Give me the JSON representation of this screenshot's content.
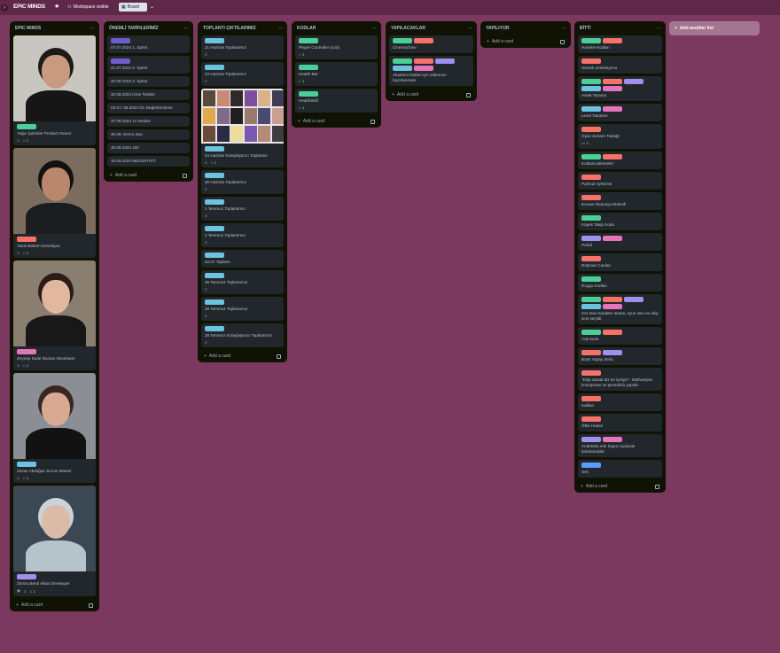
{
  "board": {
    "title": "EPIC MINDS",
    "visibility": "Workspace visible",
    "view": "Board",
    "add_list": "Add another list"
  },
  "colors": {
    "green": "#4bce97",
    "red": "#f87168",
    "purple": "#9f8fef",
    "blue": "#6cc3e0",
    "pink": "#e774bb",
    "darkpurple": "#6e5dc6",
    "cobalt": "#579dff"
  },
  "add_card_label": "Add a card",
  "lists": [
    {
      "title": "EPIC MINDS",
      "cards": [
        {
          "title": "Yağız Şahinler Product Owner",
          "labels": [
            "green"
          ],
          "badges": {
            "desc": true,
            "attach": "1"
          },
          "photo": "person-1"
        },
        {
          "title": "Yasin Bekem Developer",
          "labels": [
            "red"
          ],
          "badges": {
            "desc": true,
            "attach": "1"
          },
          "photo": "person-2"
        },
        {
          "title": "Zeynep Sude Duman Developer",
          "labels": [
            "pink"
          ],
          "badges": {
            "desc": true,
            "attach": "1"
          },
          "photo": "person-3"
        },
        {
          "title": "Zozan Akdoğan Scrum Master",
          "labels": [
            "blue"
          ],
          "badges": {
            "desc": true,
            "attach": "1"
          },
          "photo": "person-4"
        },
        {
          "title": "Zümra Betül Alkan Developer",
          "labels": [
            "purple"
          ],
          "badges": {
            "watch": true,
            "desc": true,
            "attach": "1"
          },
          "photo": "person-5"
        }
      ]
    },
    {
      "title": "ÖNEMLİ TARİHLERİMİZ",
      "cards": [
        {
          "title": "07.07.2024 1. Sprint",
          "labels": [
            "darkpurple"
          ]
        },
        {
          "title": "21.07.2024 2. Sprint",
          "labels": [
            "darkpurple"
          ]
        },
        {
          "title": "32.08.2024 3. Sprint",
          "labels": []
        },
        {
          "title": "32.08.2024 Ürün Teslimi",
          "labels": []
        },
        {
          "title": "03-07. 08.2024 Ön Değerlendirme",
          "labels": []
        },
        {
          "title": "37.08.2024 14 Reailer",
          "labels": []
        },
        {
          "title": "30.08. Demo Day",
          "labels": []
        },
        {
          "title": "30.08.2024 Jüri",
          "labels": []
        },
        {
          "title": "16.09.2024 MEZUNİYET",
          "labels": []
        }
      ]
    },
    {
      "title": "TOPLANTI ÇIKTILARIMIZ",
      "cards": [
        {
          "title": "21 Haziran Toplantımız",
          "labels": [
            "blue"
          ],
          "badges": {
            "desc": true
          }
        },
        {
          "title": "23 Haziran Toplantımız",
          "labels": [
            "blue"
          ],
          "badges": {
            "desc": true
          }
        },
        {
          "title": "24 Haziran Kolaylaştırıcı Toplantısı",
          "labels": [
            "blue"
          ],
          "badges": {
            "desc": true,
            "attach": "1"
          },
          "collage": true
        },
        {
          "title": "30 Haziran Toplantımız",
          "labels": [
            "blue"
          ],
          "badges": {
            "desc": true
          }
        },
        {
          "title": "1 Temmuz Toplantımız",
          "labels": [
            "blue"
          ],
          "badges": {
            "desc": true
          }
        },
        {
          "title": "4 Temmuz Toplantımız",
          "labels": [
            "blue"
          ],
          "badges": {
            "desc": true
          }
        },
        {
          "title": "22.07 Toplantı",
          "labels": [
            "blue"
          ],
          "badges": {}
        },
        {
          "title": "26 Temmuz Toplantımız",
          "labels": [
            "blue"
          ],
          "badges": {
            "desc": true
          }
        },
        {
          "title": "30 Temmuz Toplantımız",
          "labels": [
            "blue"
          ],
          "badges": {
            "desc": true
          }
        },
        {
          "title": "29 Temmuz Kolaylaştırıcı Toplantımız",
          "labels": [
            "blue"
          ],
          "badges": {
            "desc": true
          }
        }
      ]
    },
    {
      "title": "KODLAR",
      "cards": [
        {
          "title": "Player Controller (cod)",
          "labels": [
            "green"
          ],
          "badges": {
            "attach": "1"
          }
        },
        {
          "title": "Health Bar",
          "labels": [
            "green"
          ],
          "badges": {
            "attach": "1"
          }
        },
        {
          "title": "HealthSkill",
          "labels": [
            "green"
          ],
          "badges": {
            "attach": "1"
          }
        }
      ]
    },
    {
      "title": "YAPILACAKLAR",
      "cards": [
        {
          "title": "Cinemachine",
          "labels": [
            "green",
            "red"
          ]
        },
        {
          "title": "Akademi testleri için videonun hazırlanması",
          "labels": [
            "green",
            "red",
            "purple",
            "blue",
            "pink"
          ]
        }
      ]
    },
    {
      "title": "YAPILIYOR",
      "cards": []
    },
    {
      "title": "BİTTİ",
      "cards": [
        {
          "title": "Hareket Kodları",
          "labels": [
            "green",
            "red"
          ]
        },
        {
          "title": "Sandık animasyonu",
          "labels": [
            "red"
          ]
        },
        {
          "title": "Asset Tarama",
          "labels": [
            "green",
            "red",
            "purple",
            "blue",
            "pink"
          ]
        },
        {
          "title": "Level Tasarımı",
          "labels": [
            "blue",
            "pink"
          ]
        },
        {
          "title": "Oyun Senaro Taslağı",
          "labels": [
            "red"
          ],
          "badges": {
            "comments": "1"
          }
        },
        {
          "title": "Kodlara Bilemeler",
          "labels": [
            "green",
            "red"
          ]
        },
        {
          "title": "Partical Systems",
          "labels": [
            "red"
          ]
        },
        {
          "title": "Envaer Reposya Eklendi",
          "labels": [
            "red"
          ]
        },
        {
          "title": "Köpek Takip Kodu",
          "labels": [
            "green"
          ]
        },
        {
          "title": "Portal",
          "labels": [
            "purple",
            "pink"
          ]
        },
        {
          "title": "Düşman Canları",
          "labels": [
            "red"
          ]
        },
        {
          "title": "Duygu Kodları",
          "labels": [
            "green"
          ]
        },
        {
          "title": "2'er tane karakter asseti, oyun ismi ve ekip ismi seçildi.",
          "labels": [
            "green",
            "red",
            "purple",
            "blue",
            "pink"
          ]
        },
        {
          "title": "Ada kodu",
          "labels": [
            "green",
            "red"
          ]
        },
        {
          "title": "Boss Yapay Zeka",
          "labels": [
            "red",
            "purple"
          ]
        },
        {
          "title": "\"Ekip olarak biz en iyisiyiz\"- Motivasyon konuşması ve şenanlıklı yapıldı.",
          "labels": [
            "red"
          ]
        },
        {
          "title": "Kalkan",
          "labels": [
            "red"
          ]
        },
        {
          "title": "Öfke Hasarı",
          "labels": [
            "red"
          ]
        },
        {
          "title": "Anahtarla enir kapısı açılacak kartolacaklar",
          "labels": [
            "purple",
            "pink"
          ]
        },
        {
          "title": "Ses",
          "labels": [
            "cobalt"
          ]
        }
      ]
    }
  ]
}
